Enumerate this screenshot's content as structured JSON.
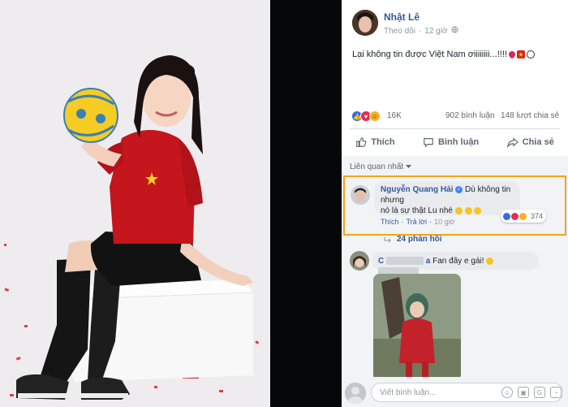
{
  "post": {
    "author": "Nhật Lê",
    "follow_label": "Theo dõi",
    "time": "12 giờ",
    "text": "Lại không tin được Việt Nam ơiiiiiiii...!!!!"
  },
  "stats": {
    "reactions": "16K",
    "comments": "902 bình luận",
    "shares": "148 lượt chia sẻ"
  },
  "actions": {
    "like": "Thích",
    "comment": "Bình luận",
    "share": "Chia sẻ"
  },
  "comments_header": {
    "sort_label": "Liên quan nhất"
  },
  "highlighted_comment": {
    "author": "Nguyễn Quang Hải",
    "text_line1": "Dù không tin nhưng",
    "text_line2": "nó là sự thật Lu nhé",
    "like": "Thích",
    "reply": "Trả lời",
    "time": "10 giờ",
    "reaction_count": "374",
    "replies": "24 phản hồi"
  },
  "second_comment": {
    "author_visible": "C",
    "author_tail": "a",
    "text": "Fan đây e gái!"
  },
  "composer": {
    "placeholder": "Viết bình luận..."
  },
  "colors": {
    "link_blue": "#385898",
    "highlight_border": "#f3a516",
    "like_blue": "#2f6ce5",
    "love_red": "#f0284a",
    "haha_yellow": "#f7b125"
  }
}
